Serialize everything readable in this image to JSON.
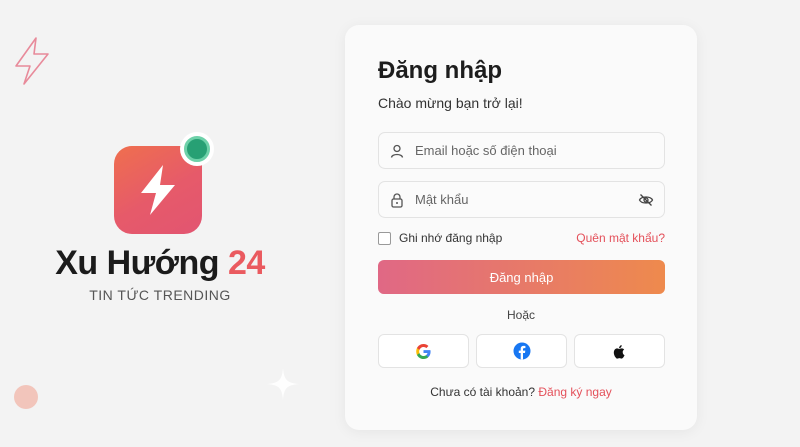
{
  "brand": {
    "name_main": "Xu Hướng",
    "name_accent": "24",
    "tagline": "TIN TỨC TRENDING"
  },
  "login": {
    "title": "Đăng nhập",
    "subtitle": "Chào mừng bạn trở lại!",
    "email_placeholder": "Email hoặc số điện thoại",
    "password_placeholder": "Mật khẩu",
    "remember_label": "Ghi nhớ đăng nhập",
    "forgot_link": "Quên mật khẩu?",
    "submit_label": "Đăng nhập",
    "or_label": "Hoặc",
    "no_account_text": "Chưa có tài khoản?",
    "signup_link": "Đăng ký ngay"
  },
  "social": [
    {
      "name": "Google",
      "icon": "google-icon"
    },
    {
      "name": "Facebook",
      "icon": "facebook-icon"
    },
    {
      "name": "Apple",
      "icon": "apple-icon"
    }
  ],
  "colors": {
    "accent": "#e4505a",
    "gradient_start": "#e06885",
    "gradient_end": "#ee8a4d",
    "badge_green": "#27a074"
  }
}
